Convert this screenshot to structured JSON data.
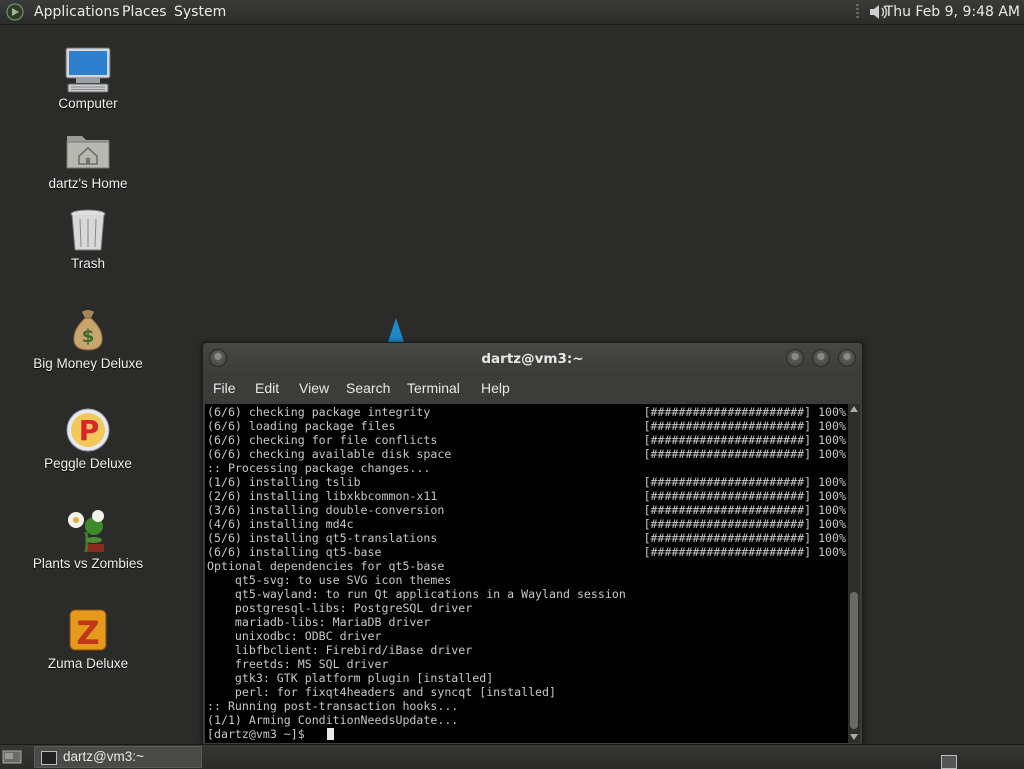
{
  "top_panel": {
    "menus": [
      "Applications",
      "Places",
      "System"
    ],
    "clock": "Thu Feb  9,  9:48 AM"
  },
  "desktop_icons": [
    {
      "label": "Computer",
      "icon": "computer-icon"
    },
    {
      "label": "dartz's Home",
      "icon": "home-folder-icon"
    },
    {
      "label": "Trash",
      "icon": "trash-icon"
    },
    {
      "label": "Big Money Deluxe",
      "icon": "money-bag-icon"
    },
    {
      "label": "Peggle Deluxe",
      "icon": "peggle-icon"
    },
    {
      "label": "Plants vs Zombies",
      "icon": "plants-vs-zombies-icon"
    },
    {
      "label": "Zuma Deluxe",
      "icon": "zuma-icon"
    }
  ],
  "terminal": {
    "title": "dartz@vm3:~",
    "menu": [
      "File",
      "Edit",
      "View",
      "Search",
      "Terminal",
      "Help"
    ],
    "lines": [
      {
        "text": "(6/6) checking package integrity",
        "progress": "[######################] 100%"
      },
      {
        "text": "(6/6) loading package files",
        "progress": "[######################] 100%"
      },
      {
        "text": "(6/6) checking for file conflicts",
        "progress": "[######################] 100%"
      },
      {
        "text": "(6/6) checking available disk space",
        "progress": "[######################] 100%"
      },
      {
        "text": ":: Processing package changes...",
        "progress": ""
      },
      {
        "text": "(1/6) installing tslib",
        "progress": "[######################] 100%"
      },
      {
        "text": "(2/6) installing libxkbcommon-x11",
        "progress": "[######################] 100%"
      },
      {
        "text": "(3/6) installing double-conversion",
        "progress": "[######################] 100%"
      },
      {
        "text": "(4/6) installing md4c",
        "progress": "[######################] 100%"
      },
      {
        "text": "(5/6) installing qt5-translations",
        "progress": "[######################] 100%"
      },
      {
        "text": "(6/6) installing qt5-base",
        "progress": "[######################] 100%"
      },
      {
        "text": "Optional dependencies for qt5-base",
        "progress": ""
      },
      {
        "text": "    qt5-svg: to use SVG icon themes",
        "progress": ""
      },
      {
        "text": "    qt5-wayland: to run Qt applications in a Wayland session",
        "progress": ""
      },
      {
        "text": "    postgresql-libs: PostgreSQL driver",
        "progress": ""
      },
      {
        "text": "    mariadb-libs: MariaDB driver",
        "progress": ""
      },
      {
        "text": "    unixodbc: ODBC driver",
        "progress": ""
      },
      {
        "text": "    libfbclient: Firebird/iBase driver",
        "progress": ""
      },
      {
        "text": "    freetds: MS SQL driver",
        "progress": ""
      },
      {
        "text": "    gtk3: GTK platform plugin [installed]",
        "progress": ""
      },
      {
        "text": "    perl: for fixqt4headers and syncqt [installed]",
        "progress": ""
      },
      {
        "text": ":: Running post-transaction hooks...",
        "progress": ""
      },
      {
        "text": "(1/1) Arming ConditionNeedsUpdate...",
        "progress": ""
      },
      {
        "text": "[dartz@vm3 ~]$ ",
        "progress": ""
      }
    ]
  },
  "taskbar": {
    "window_label": "dartz@vm3:~"
  }
}
